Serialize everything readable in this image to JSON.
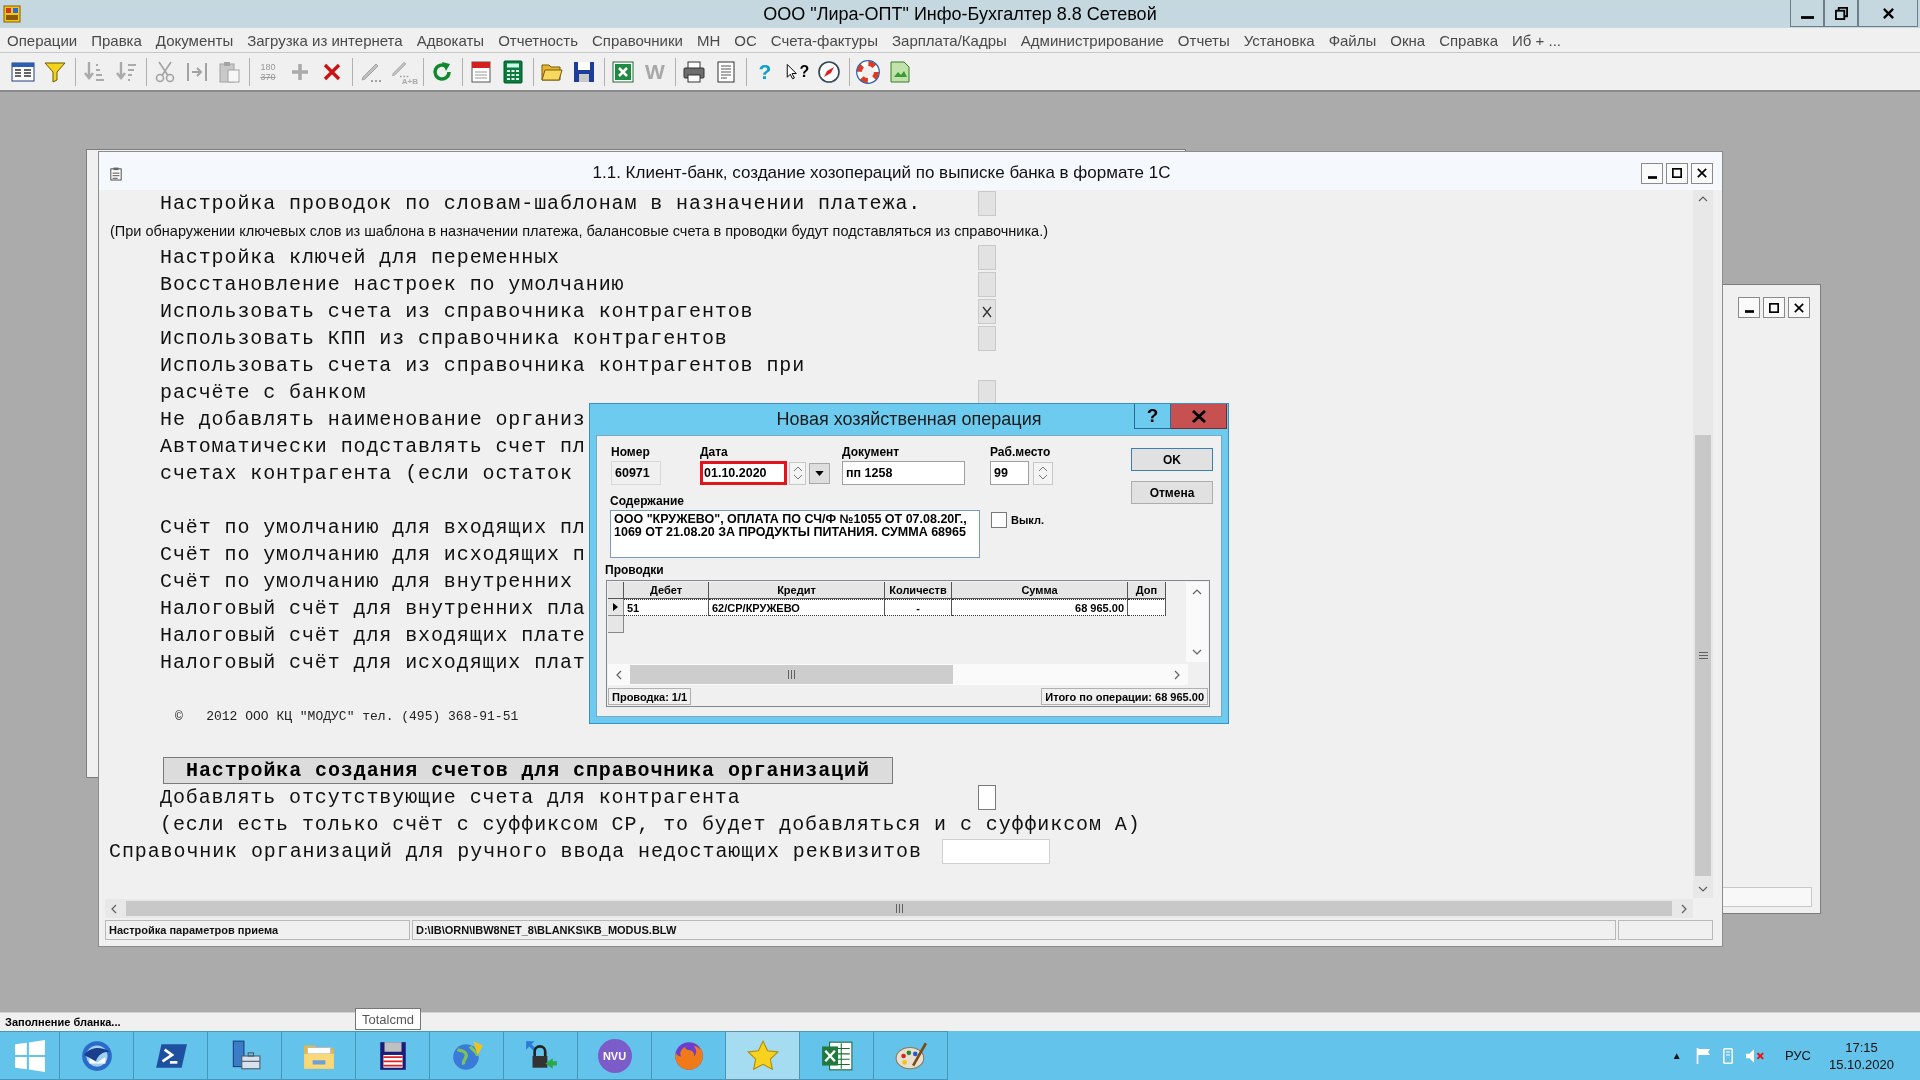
{
  "title_bar": {
    "title": "ООО \"Лира-ОПТ\" Инфо-Бухгалтер 8.8 Сетевой"
  },
  "menu": [
    "Операции",
    "Правка",
    "Документы",
    "Загрузка из интернета",
    "Адвокаты",
    "Отчетность",
    "Справочники",
    "МН",
    "ОС",
    "Счета-фактуры",
    "Зарплата/Кадры",
    "Администрирование",
    "Отчеты",
    "Установка",
    "Файлы",
    "Окна",
    "Справка",
    "Иб + ..."
  ],
  "toolbar": [
    {
      "items": [
        {
          "kind": "table",
          "disabled": false
        },
        {
          "kind": "filter",
          "disabled": false
        }
      ]
    },
    {
      "items": [
        {
          "kind": "sortasc",
          "disabled": true
        },
        {
          "kind": "sortdesc",
          "disabled": true
        }
      ]
    },
    {
      "items": [
        {
          "kind": "cut",
          "disabled": true
        },
        {
          "kind": "insert",
          "disabled": true
        },
        {
          "kind": "paste",
          "disabled": true
        }
      ]
    },
    {
      "items": [
        {
          "kind": "numbers",
          "lines": [
            "180",
            "370"
          ],
          "disabled": true
        },
        {
          "kind": "plus",
          "disabled": true
        },
        {
          "kind": "delete",
          "disabled": false
        }
      ]
    },
    {
      "items": [
        {
          "kind": "pen",
          "disabled": true
        },
        {
          "kind": "pen",
          "caption": "A+B",
          "disabled": true
        }
      ]
    },
    {
      "items": [
        {
          "kind": "refresh",
          "disabled": false
        }
      ]
    },
    {
      "items": [
        {
          "kind": "calendar",
          "disabled": false
        },
        {
          "kind": "calculator",
          "disabled": false
        }
      ]
    },
    {
      "items": [
        {
          "kind": "open",
          "disabled": false
        },
        {
          "kind": "save",
          "disabled": false
        }
      ]
    },
    {
      "items": [
        {
          "kind": "sheet",
          "disabled": false
        },
        {
          "kind": "letter",
          "caption": "W",
          "disabled": true
        }
      ]
    },
    {
      "items": [
        {
          "kind": "print",
          "disabled": false
        },
        {
          "kind": "page",
          "disabled": false
        }
      ]
    },
    {
      "items": [
        {
          "kind": "letter",
          "caption": "?",
          "disabled": false
        },
        {
          "kind": "cursor",
          "caption": "?",
          "disabled": false
        },
        {
          "kind": "compass",
          "disabled": false
        }
      ]
    },
    {
      "items": [
        {
          "kind": "lifebuoy",
          "disabled": false
        },
        {
          "kind": "map",
          "disabled": false
        }
      ]
    }
  ],
  "main_window": {
    "title": "1.1. Клиент-банк, создание хозопераций по выписке банка в формате 1С",
    "sections": [
      {
        "rows": [
          {
            "kind": "option",
            "text": "Настройка проводок по словам-шаблонам в назначении платежа.",
            "checkbox": {
              "checked": false,
              "disabled": true
            }
          },
          {
            "kind": "note",
            "text": "(При обнаружении ключевых слов из шаблона в назначении платежа, балансовые счета в проводки будут подставляться из справочника.)"
          },
          {
            "kind": "option",
            "text": "Настройка ключей для переменных",
            "checkbox": {
              "checked": false,
              "disabled": true
            }
          },
          {
            "kind": "option",
            "text": "Восстановление настроек по умолчанию",
            "checkbox": {
              "checked": false,
              "disabled": true
            }
          },
          {
            "kind": "option",
            "text": "Использовать счета из справочника контрагентов",
            "checkbox": {
              "checked": true,
              "disabled": true
            }
          },
          {
            "kind": "option",
            "text": "Использовать КПП из справочника контрагентов",
            "checkbox": {
              "checked": false,
              "disabled": true
            }
          },
          {
            "kind": "option",
            "text": "Использовать счета из справочника контрагентов при"
          },
          {
            "kind": "option",
            "text": "расчёте с банком",
            "checkbox": {
              "checked": false,
              "disabled": true
            }
          },
          {
            "kind": "option",
            "text": "Не добавлять наименование организ"
          },
          {
            "kind": "option",
            "text": "Автоматически подставлять счет пл"
          },
          {
            "kind": "option",
            "text": "счетах контрагента (если остаток"
          }
        ]
      },
      {
        "rows": [
          {
            "kind": "option",
            "text": "Счёт по умолчанию для входящих пл"
          },
          {
            "kind": "option",
            "text": "Счёт по умолчанию для исходящих п"
          },
          {
            "kind": "option",
            "text": "Счёт по умолчанию для внутренних"
          },
          {
            "kind": "option",
            "text": "Налоговый счёт для внутренних пла"
          },
          {
            "kind": "option",
            "text": "Налоговый счёт для входящих плате"
          },
          {
            "kind": "option",
            "text": "Налоговый счёт для исходящих плат"
          }
        ]
      },
      {
        "rows": [
          {
            "kind": "copyright",
            "text": "©   2012 ООО КЦ \"МОДУС\" тел. (495) 368-91-51"
          }
        ]
      },
      {
        "heading": "Настройка создания счетов для справочника организаций",
        "rows": [
          {
            "kind": "option",
            "text": "Добавлять отсутствующие счета для контрагента",
            "checkbox": {
              "checked": false,
              "disabled": false
            }
          },
          {
            "kind": "option",
            "text": "(если есть только счёт с суффиксом СР, то будет добавляться и с суффиксом А)"
          },
          {
            "kind": "field",
            "text": "Справочник организаций для ручного ввода недостающих реквизитов"
          }
        ]
      }
    ],
    "status": [
      "Настройка параметров приема",
      "D:\\IB\\ORN\\IBW8NET_8\\BLANKS\\KB_MODUS.BLW"
    ]
  },
  "dialog": {
    "title": "Новая хозяйственная операция",
    "help": "?",
    "fields": [
      {
        "kind": "readonly",
        "label": "Номер",
        "value": "60971",
        "highlighted": false
      },
      {
        "kind": "date",
        "label": "Дата",
        "value": "01.10.2020",
        "highlighted": true
      },
      {
        "kind": "text",
        "label": "Документ",
        "value": "пп 1258",
        "highlighted": false
      },
      {
        "kind": "spin",
        "label": "Раб.место",
        "value": "99",
        "highlighted": false
      }
    ],
    "content": {
      "label": "Содержание",
      "lines": [
        "ООО \"КРУЖЕВО\", ОПЛАТА ПО СЧ/Ф №1055 ОТ 07.08.20Г.,",
        "1069 ОТ 21.08.20 ЗА ПРОДУКТЫ ПИТАНИЯ. СУММА 68965"
      ]
    },
    "off_checkbox": {
      "label": "Выкл.",
      "checked": false
    },
    "buttons": [
      "OK",
      "Отмена"
    ],
    "grid": {
      "label": "Проводки",
      "columns": [
        "Дебет",
        "Кредит",
        "Количеств",
        "Сумма",
        "Доп"
      ],
      "rows": [
        {
          "cells": [
            "51",
            "62/СР/КРУЖЕВО",
            "-",
            "68 965.00"
          ],
          "selected": true
        }
      ],
      "footer_left": "Проводка: 1/1",
      "footer_right": "Итого по операции: 68 965.00"
    }
  },
  "status_bar": {
    "text": "Заполнение бланка..."
  },
  "tooltip": {
    "text": "Totalcmd"
  },
  "taskbar": {
    "apps": [
      {
        "kind": "start",
        "active": false
      },
      {
        "kind": "mail",
        "active": false
      },
      {
        "kind": "terminal",
        "active": false
      },
      {
        "kind": "toolbox",
        "active": false
      },
      {
        "kind": "folder",
        "active": false
      },
      {
        "kind": "floppy",
        "active": false
      },
      {
        "kind": "globe",
        "active": false
      },
      {
        "kind": "lock",
        "active": false
      },
      {
        "kind": "badge",
        "caption": "NVU",
        "active": false
      },
      {
        "kind": "fox",
        "active": false
      },
      {
        "kind": "star",
        "active": true
      },
      {
        "kind": "sheet",
        "active": false
      },
      {
        "kind": "palette",
        "active": false
      }
    ],
    "tray": {
      "overflow": "▲",
      "language": "РУС",
      "time": "17:15",
      "date": "15.10.2020"
    }
  }
}
